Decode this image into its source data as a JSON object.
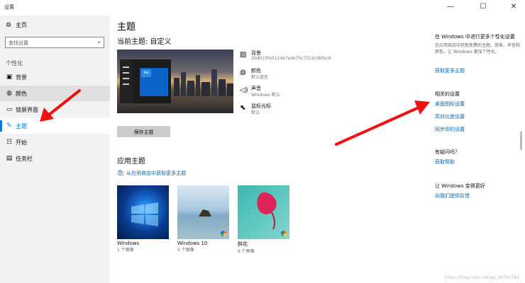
{
  "window": {
    "title": "设置",
    "minimize": "—",
    "maximize": "☐",
    "close": "✕"
  },
  "sidebar": {
    "home": "主页",
    "search_placeholder": "查找设置",
    "section": "个性化",
    "items": [
      {
        "label": "背景",
        "icon": "image-icon"
      },
      {
        "label": "颜色",
        "icon": "palette-icon"
      },
      {
        "label": "锁屏界面",
        "icon": "lock-screen-icon"
      },
      {
        "label": "主题",
        "icon": "theme-icon",
        "selected": true
      },
      {
        "label": "开始",
        "icon": "start-icon"
      },
      {
        "label": "任务栏",
        "icon": "taskbar-icon"
      }
    ]
  },
  "main": {
    "title": "主题",
    "current_theme": "当前主题: 自定义",
    "tile_text": "Aa",
    "attributes": [
      {
        "title": "背景",
        "sub": "2bd015fa012da7ade75c7012c6bfac6"
      },
      {
        "title": "颜色",
        "sub": "默认蓝色"
      },
      {
        "title": "声音",
        "sub": "Windows 默认"
      },
      {
        "title": "鼠标光标",
        "sub": "默认"
      }
    ],
    "save_button": "保存主题",
    "apply_heading": "应用主题",
    "store_link": "从应用商店中获取更多主题",
    "themes": [
      {
        "name": "Windows",
        "count": "1 个图像"
      },
      {
        "name": "Windows 10",
        "count": "5 个图像"
      },
      {
        "name": "鲜花",
        "count": "6 个图像"
      }
    ]
  },
  "right": {
    "sync_heading": "在 Windows 中进行更多个性化设置",
    "sync_text": "在应用商店中获取免费的主题、背景、声音和颜色，让 Windows 更加个性化。",
    "sync_link": "获取更多主题",
    "related_heading": "相关的设置",
    "related_links": [
      "桌面图标设置",
      "高对比度设置",
      "同步你的设置"
    ],
    "question_heading": "有疑问吗？",
    "help_link": "获取帮助",
    "improve_heading": "让 Windows 变得更好",
    "feedback_link": "向我们提供反馈"
  },
  "watermark": "https://blog.csdn.net/qq_39782764",
  "colors": {
    "accent": "#0078d7",
    "link": "#0067b8",
    "annotation": "#ee1111"
  }
}
